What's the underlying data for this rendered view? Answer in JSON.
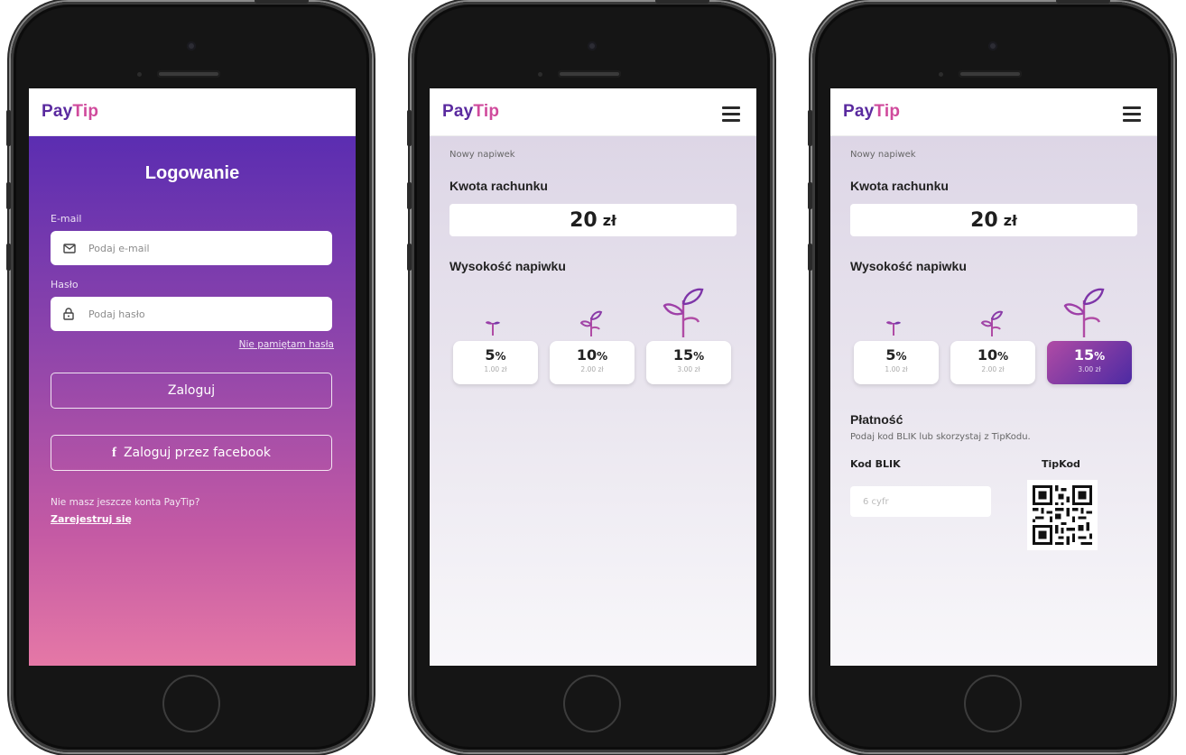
{
  "brand": {
    "pay": "Pay",
    "tip": "Tip"
  },
  "login": {
    "title": "Logowanie",
    "email_label": "E-mail",
    "email_placeholder": "Podaj e-mail",
    "password_label": "Hasło",
    "password_placeholder": "Podaj hasło",
    "forgot": "Nie pamiętam hasła",
    "login_button": "Zaloguj",
    "facebook_button": "Zaloguj przez facebook",
    "no_account": "Nie masz jeszcze konta PayTip?",
    "register": "Zarejestruj się"
  },
  "tip": {
    "section": "Nowy napiwek",
    "bill_heading": "Kwota rachunku",
    "amount": "20",
    "currency": "zł",
    "tip_heading": "Wysokość napiwku",
    "options": [
      {
        "pct": "5",
        "unit": "%",
        "sub": "1.00 zł"
      },
      {
        "pct": "10",
        "unit": "%",
        "sub": "2.00 zł"
      },
      {
        "pct": "15",
        "unit": "%",
        "sub": "3.00 zł"
      }
    ],
    "payment_heading": "Płatność",
    "payment_desc": "Podaj kod BLIK lub skorzystaj z TipKodu.",
    "blik_label": "Kod BLIK",
    "blik_placeholder": "6 cyfr",
    "tipkod_label": "TipKod"
  },
  "colors": {
    "accent": "#5b2db1",
    "accent_pink": "#d04a9c"
  }
}
